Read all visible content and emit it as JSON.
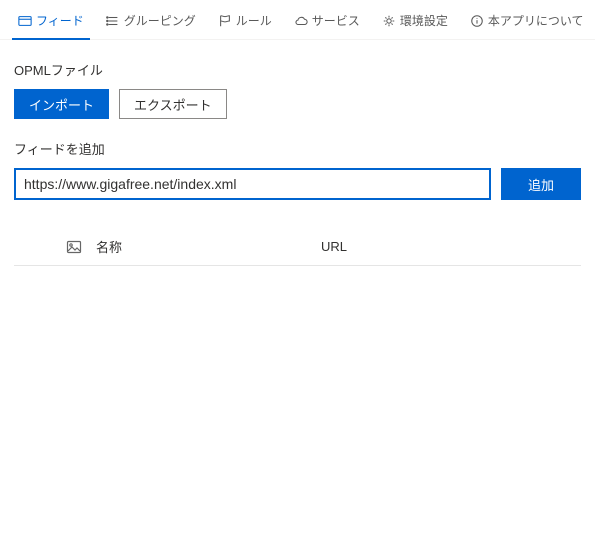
{
  "tabs": [
    {
      "label": "フィード"
    },
    {
      "label": "グルーピング"
    },
    {
      "label": "ルール"
    },
    {
      "label": "サービス"
    },
    {
      "label": "環境設定"
    },
    {
      "label": "本アプリについて"
    }
  ],
  "opml": {
    "section_label": "OPMLファイル",
    "import_label": "インポート",
    "export_label": "エクスポート"
  },
  "add_feed": {
    "section_label": "フィードを追加",
    "url_value": "https://www.gigafree.net/index.xml",
    "add_label": "追加"
  },
  "table": {
    "col_name": "名称",
    "col_url": "URL"
  }
}
